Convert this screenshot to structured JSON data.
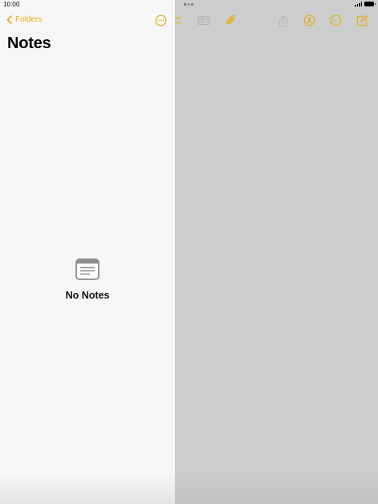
{
  "status_bar": {
    "time": "10:00"
  },
  "sidebar": {
    "back_label": "Folders",
    "title": "Notes",
    "empty_label": "No Notes"
  },
  "toolbar": {
    "icons": [
      "checklist-icon",
      "table-icon",
      "attachment-icon",
      "share-icon",
      "markup-icon",
      "more-icon",
      "compose-icon"
    ]
  },
  "colors": {
    "accent": "#e3ad17",
    "sidebar_bg": "#f7f7f7",
    "dimmed_bg": "#cdcdcd",
    "disabled_icon": "#b5b5b5"
  }
}
